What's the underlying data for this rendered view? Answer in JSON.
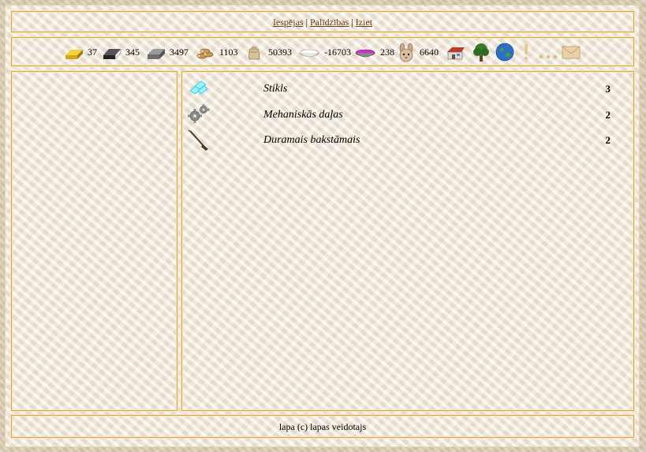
{
  "nav": {
    "links": [
      {
        "label": "Iespējas"
      },
      {
        "label": "Palīdzības"
      },
      {
        "label": "Iziet"
      }
    ],
    "separator": "|"
  },
  "resources": [
    {
      "icon": "gold-bar-icon",
      "value": "37"
    },
    {
      "icon": "iron-ingot-icon",
      "value": "345"
    },
    {
      "icon": "stone-block-icon",
      "value": "3497"
    },
    {
      "icon": "wood-logs-icon",
      "value": "1103"
    },
    {
      "icon": "grain-sack-icon",
      "value": "50393"
    },
    {
      "icon": "salt-bowl-icon",
      "value": "-16703"
    },
    {
      "icon": "dye-bowl-icon",
      "value": "238"
    },
    {
      "icon": "rabbit-icon",
      "value": "6640"
    }
  ],
  "nav_icons": [
    "house-icon",
    "tree-icon",
    "globe-icon",
    "exclamation-icon",
    "ellipsis-icon",
    "mail-icon"
  ],
  "items": [
    {
      "icon": "glass-icon",
      "name": "Stikls",
      "count": "3"
    },
    {
      "icon": "gears-icon",
      "name": "Mehaniskās daļas",
      "count": "2"
    },
    {
      "icon": "spear-icon",
      "name": "Duramais bakstāmais",
      "count": "2"
    }
  ],
  "footer": {
    "text": "lapa (c) lapas veidotajs"
  },
  "colors": {
    "border": "#d4a94a",
    "link": "#6b3d12",
    "panel_bg": "#f1e9dc"
  }
}
